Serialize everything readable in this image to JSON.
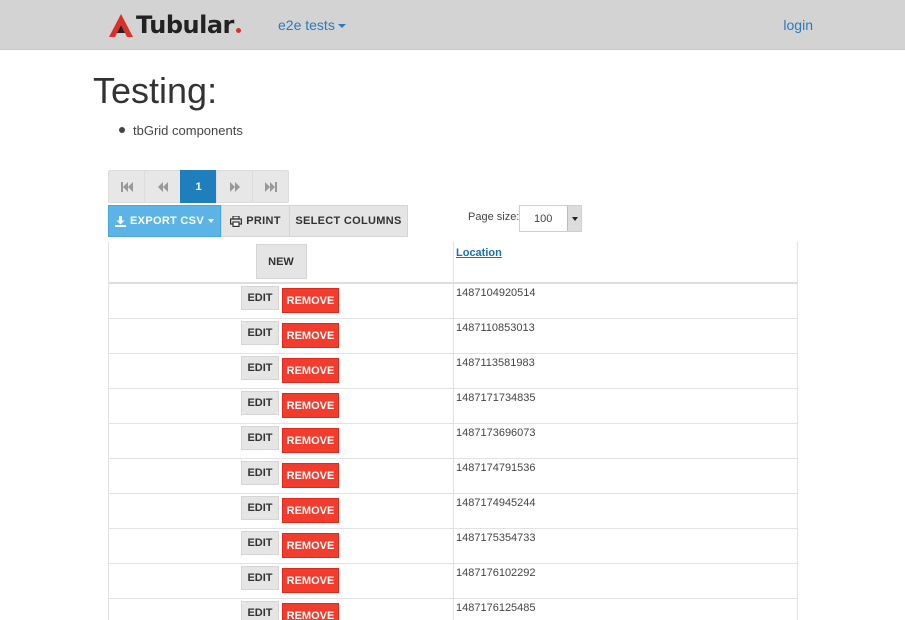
{
  "navbar": {
    "brand": "Tubular",
    "dropdown_label": "e2e tests",
    "login_label": "login",
    "brand_color": "#d9302c"
  },
  "page": {
    "title": "Testing:",
    "bullets": [
      "tbGrid components"
    ]
  },
  "pager": {
    "current_page": "1",
    "icons": [
      "first-page-icon",
      "previous-page-icon",
      "next-page-icon",
      "last-page-icon"
    ],
    "active_color": "#1f7fbd"
  },
  "toolbar": {
    "export_label": "EXPORT CSV",
    "print_label": "PRINT",
    "columns_label": "SELECT COLUMNS",
    "export_color": "#5bb3e6"
  },
  "page_size": {
    "label": "Page size:",
    "value": "100"
  },
  "grid": {
    "new_label": "NEW",
    "location_header": "Location",
    "edit_label": "EDIT",
    "remove_label": "REMOVE",
    "remove_color": "#f23c2d",
    "rows": [
      {
        "location": "1487104920514"
      },
      {
        "location": "1487110853013"
      },
      {
        "location": "1487113581983"
      },
      {
        "location": "1487171734835"
      },
      {
        "location": "1487173696073"
      },
      {
        "location": "1487174791536"
      },
      {
        "location": "1487174945244"
      },
      {
        "location": "1487175354733"
      },
      {
        "location": "1487176102292"
      },
      {
        "location": "1487176125485"
      }
    ]
  }
}
